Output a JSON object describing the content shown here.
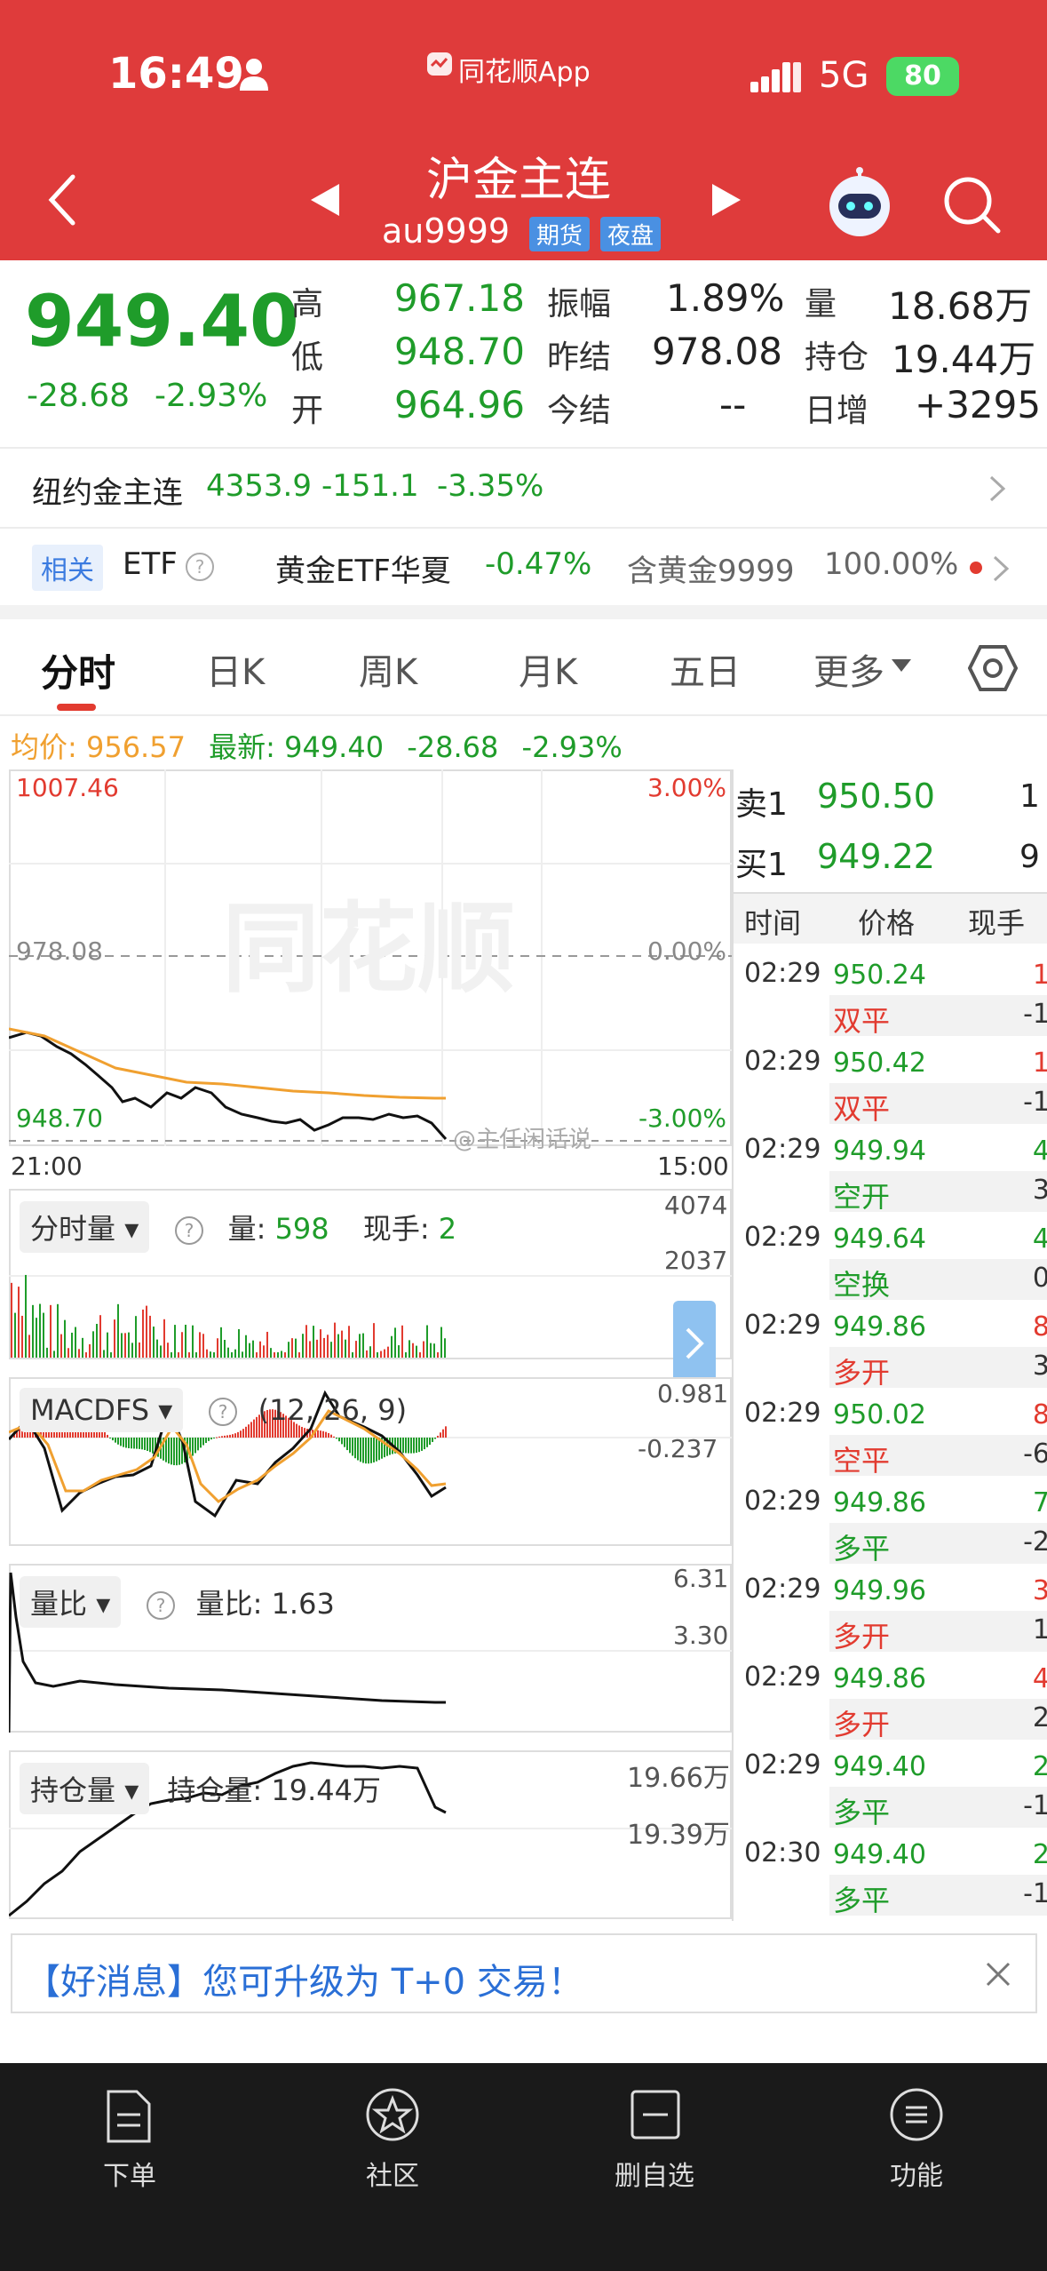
{
  "status_bar": {
    "time": "16:49",
    "app_name": "同花顺App",
    "network": "5G",
    "battery": "80"
  },
  "header": {
    "title": "沪金主连",
    "code": "au9999",
    "tag_futures": "期货",
    "tag_night": "夜盘"
  },
  "quote": {
    "price": "949.40",
    "change": "-28.68",
    "change_pct": "-2.93%",
    "fields": [
      {
        "label": "高",
        "value": "967.18"
      },
      {
        "label": "低",
        "value": "948.70"
      },
      {
        "label": "开",
        "value": "964.96"
      },
      {
        "label": "振幅",
        "value": "1.89%"
      },
      {
        "label": "昨结",
        "value": "978.08"
      },
      {
        "label": "今结",
        "value": "--"
      },
      {
        "label": "量",
        "value": "18.68万"
      },
      {
        "label": "持仓",
        "value": "19.44万"
      },
      {
        "label": "日增",
        "value": "+3295"
      }
    ]
  },
  "ny_gold": {
    "label": "纽约金主连",
    "price": "4353.9",
    "change": "-151.1",
    "change_pct": "-3.35%"
  },
  "related": {
    "tag": "相关",
    "etf_label": "ETF",
    "etf_name": "黄金ETF华夏",
    "etf_change": "-0.47%",
    "gold_label": "含黄金9999",
    "gold_pct": "100.00%"
  },
  "tabs": [
    "分时",
    "日K",
    "周K",
    "月K",
    "五日",
    "更多"
  ],
  "stats_line": {
    "avg_label": "均价:",
    "avg": "956.57",
    "last_label": "最新:",
    "last": "949.40",
    "change": "-28.68",
    "change_pct": "-2.93%"
  },
  "main_chart": {
    "y_top": "1007.46",
    "y_mid": "978.08",
    "y_bot": "948.70",
    "pct_top": "3.00%",
    "pct_mid": "0.00%",
    "pct_bot": "-3.00%",
    "t_start": "21:00",
    "t_end": "15:00",
    "watermark": "同花顺",
    "weibo_watermark": "@主任闲话说"
  },
  "order_book": {
    "sell_label": "卖1",
    "sell_price": "950.50",
    "sell_qty": "1",
    "buy_label": "买1",
    "buy_price": "949.22",
    "buy_qty": "9"
  },
  "tick_header": {
    "time": "时间",
    "price": "价格",
    "qty": "现手"
  },
  "ticks": [
    {
      "time": "02:29",
      "price": "950.24",
      "vol": "1",
      "type": "双平",
      "chg": "-1"
    },
    {
      "time": "02:29",
      "price": "950.42",
      "vol": "1",
      "type": "双平",
      "chg": "-1"
    },
    {
      "time": "02:29",
      "price": "949.94",
      "vol": "4",
      "type": "空开",
      "chg": "3"
    },
    {
      "time": "02:29",
      "price": "949.64",
      "vol": "4",
      "type": "空换",
      "chg": "0"
    },
    {
      "time": "02:29",
      "price": "949.86",
      "vol": "8",
      "type": "多开",
      "chg": "3"
    },
    {
      "time": "02:29",
      "price": "950.02",
      "vol": "8",
      "type": "空平",
      "chg": "-6"
    },
    {
      "time": "02:29",
      "price": "949.86",
      "vol": "7",
      "type": "多平",
      "chg": "-2"
    },
    {
      "time": "02:29",
      "price": "949.96",
      "vol": "3",
      "type": "多开",
      "chg": "1"
    },
    {
      "time": "02:29",
      "price": "949.86",
      "vol": "4",
      "type": "多开",
      "chg": "2"
    },
    {
      "time": "02:29",
      "price": "949.40",
      "vol": "2",
      "type": "多平",
      "chg": "-1"
    },
    {
      "time": "02:30",
      "price": "949.40",
      "vol": "2",
      "type": "多平",
      "chg": "-1"
    }
  ],
  "volume_panel": {
    "label": "分时量",
    "vol_label": "量:",
    "vol": "598",
    "hand_label": "现手:",
    "hand": "2",
    "y_top": "4074",
    "y_mid": "2037"
  },
  "macd_panel": {
    "label": "MACDFS",
    "params": "(12, 26, 9)",
    "y_top": "0.981",
    "y_mid": "-0.237"
  },
  "ratio_panel": {
    "label": "量比",
    "value_label": "量比:",
    "value": "1.63",
    "y_top": "6.31",
    "y_mid": "3.30"
  },
  "oi_panel": {
    "label": "持仓量",
    "value_label": "持仓量:",
    "value": "19.44万",
    "y_top": "19.66万",
    "y_mid": "19.39万"
  },
  "banner": {
    "text": "【好消息】您可升级为 T+0 交易！"
  },
  "bottom_nav": [
    {
      "label": "下单",
      "icon": "order-doc-icon"
    },
    {
      "label": "社区",
      "icon": "community-star-icon"
    },
    {
      "label": "删自选",
      "icon": "remove-watchlist-icon"
    },
    {
      "label": "功能",
      "icon": "menu-list-icon"
    }
  ],
  "colors": {
    "header_red": "#df3b3b",
    "down_green": "#1f9c2a",
    "up_red": "#e23b30",
    "avg_orange": "#f0a030",
    "tag_blue": "#4a90e2"
  }
}
